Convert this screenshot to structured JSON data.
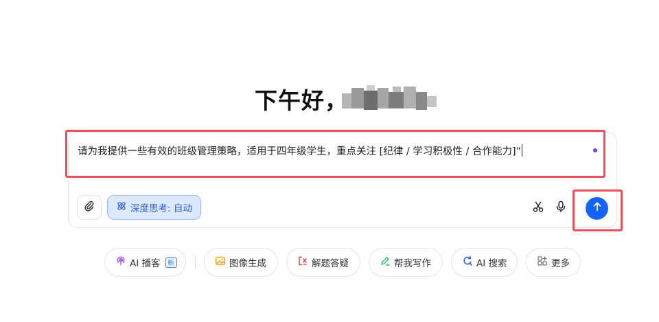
{
  "greeting": {
    "text": "下午好，"
  },
  "chat_input": {
    "value": "请为我提供一些有效的班级管理策略，适用于四年级学生，重点关注 [纪律 / 学习积极性 / 合作能力]”"
  },
  "toolbar": {
    "attach_icon": "paperclip-icon",
    "deep_think_label": "深度思考: 自动",
    "deep_think_icon": "atom-icon",
    "scissors_icon": "scissors-icon",
    "mic_icon": "microphone-icon",
    "send_icon": "arrow-up-icon"
  },
  "chips": [
    {
      "label": "AI 播客",
      "icon": "podcast-icon",
      "badge": "新"
    },
    {
      "label": "图像生成",
      "icon": "image-icon"
    },
    {
      "label": "解题答疑",
      "icon": "formula-icon"
    },
    {
      "label": "帮我写作",
      "icon": "pen-icon"
    },
    {
      "label": "AI 搜索",
      "icon": "search-refresh-icon"
    },
    {
      "label": "更多",
      "icon": "grid-plus-icon"
    }
  ],
  "colors": {
    "accent": "#1464f6",
    "highlight": "#e8505b",
    "deep_think_bg": "#dbe8fe",
    "deep_think_text": "#2f62d8"
  }
}
